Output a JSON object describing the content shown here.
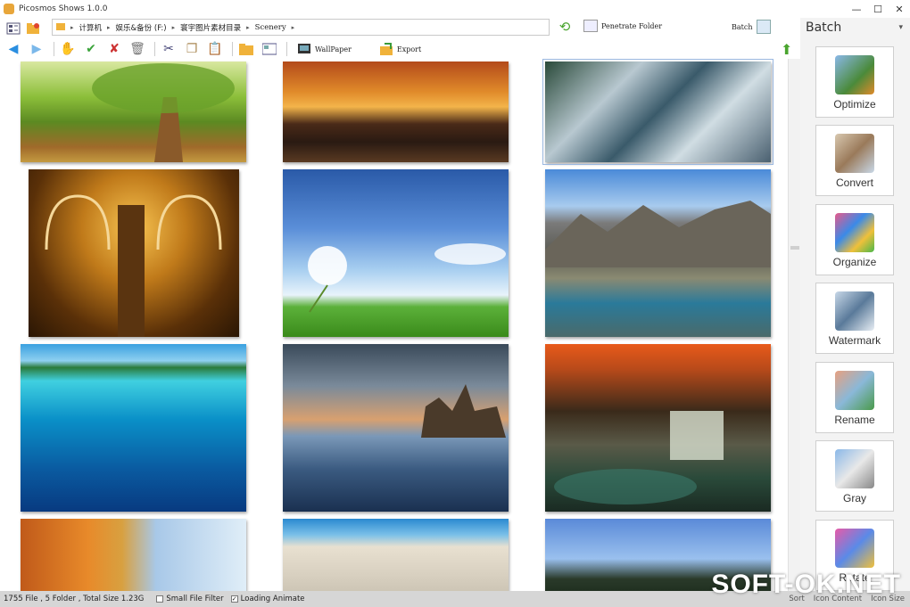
{
  "window": {
    "title": "Picosmos Shows 1.0.0"
  },
  "address": {
    "segments": [
      "计算机",
      "娱乐&备份 (F:)",
      "寰宇图片素材目录",
      "Scenery"
    ]
  },
  "toolbar": {
    "penetrate_label": "Penetrate Folder",
    "batch_label": "Batch",
    "wallpaper_label": "WallPaper",
    "export_label": "Export"
  },
  "panel": {
    "title": "Batch",
    "items": [
      {
        "label": "Optimize"
      },
      {
        "label": "Convert"
      },
      {
        "label": "Organize"
      },
      {
        "label": "Watermark"
      },
      {
        "label": "Rename"
      },
      {
        "label": "Gray"
      },
      {
        "label": "Rotate"
      }
    ]
  },
  "status": {
    "summary": "1755 File , 5 Folder , Total Size 1.23G",
    "small_filter": "Small File Filter",
    "loading": "Loading Animate",
    "sort": "Sort",
    "icon_content": "Icon Content",
    "icon_size": "Icon Size"
  },
  "watermark": "SOFT-OK.NET"
}
